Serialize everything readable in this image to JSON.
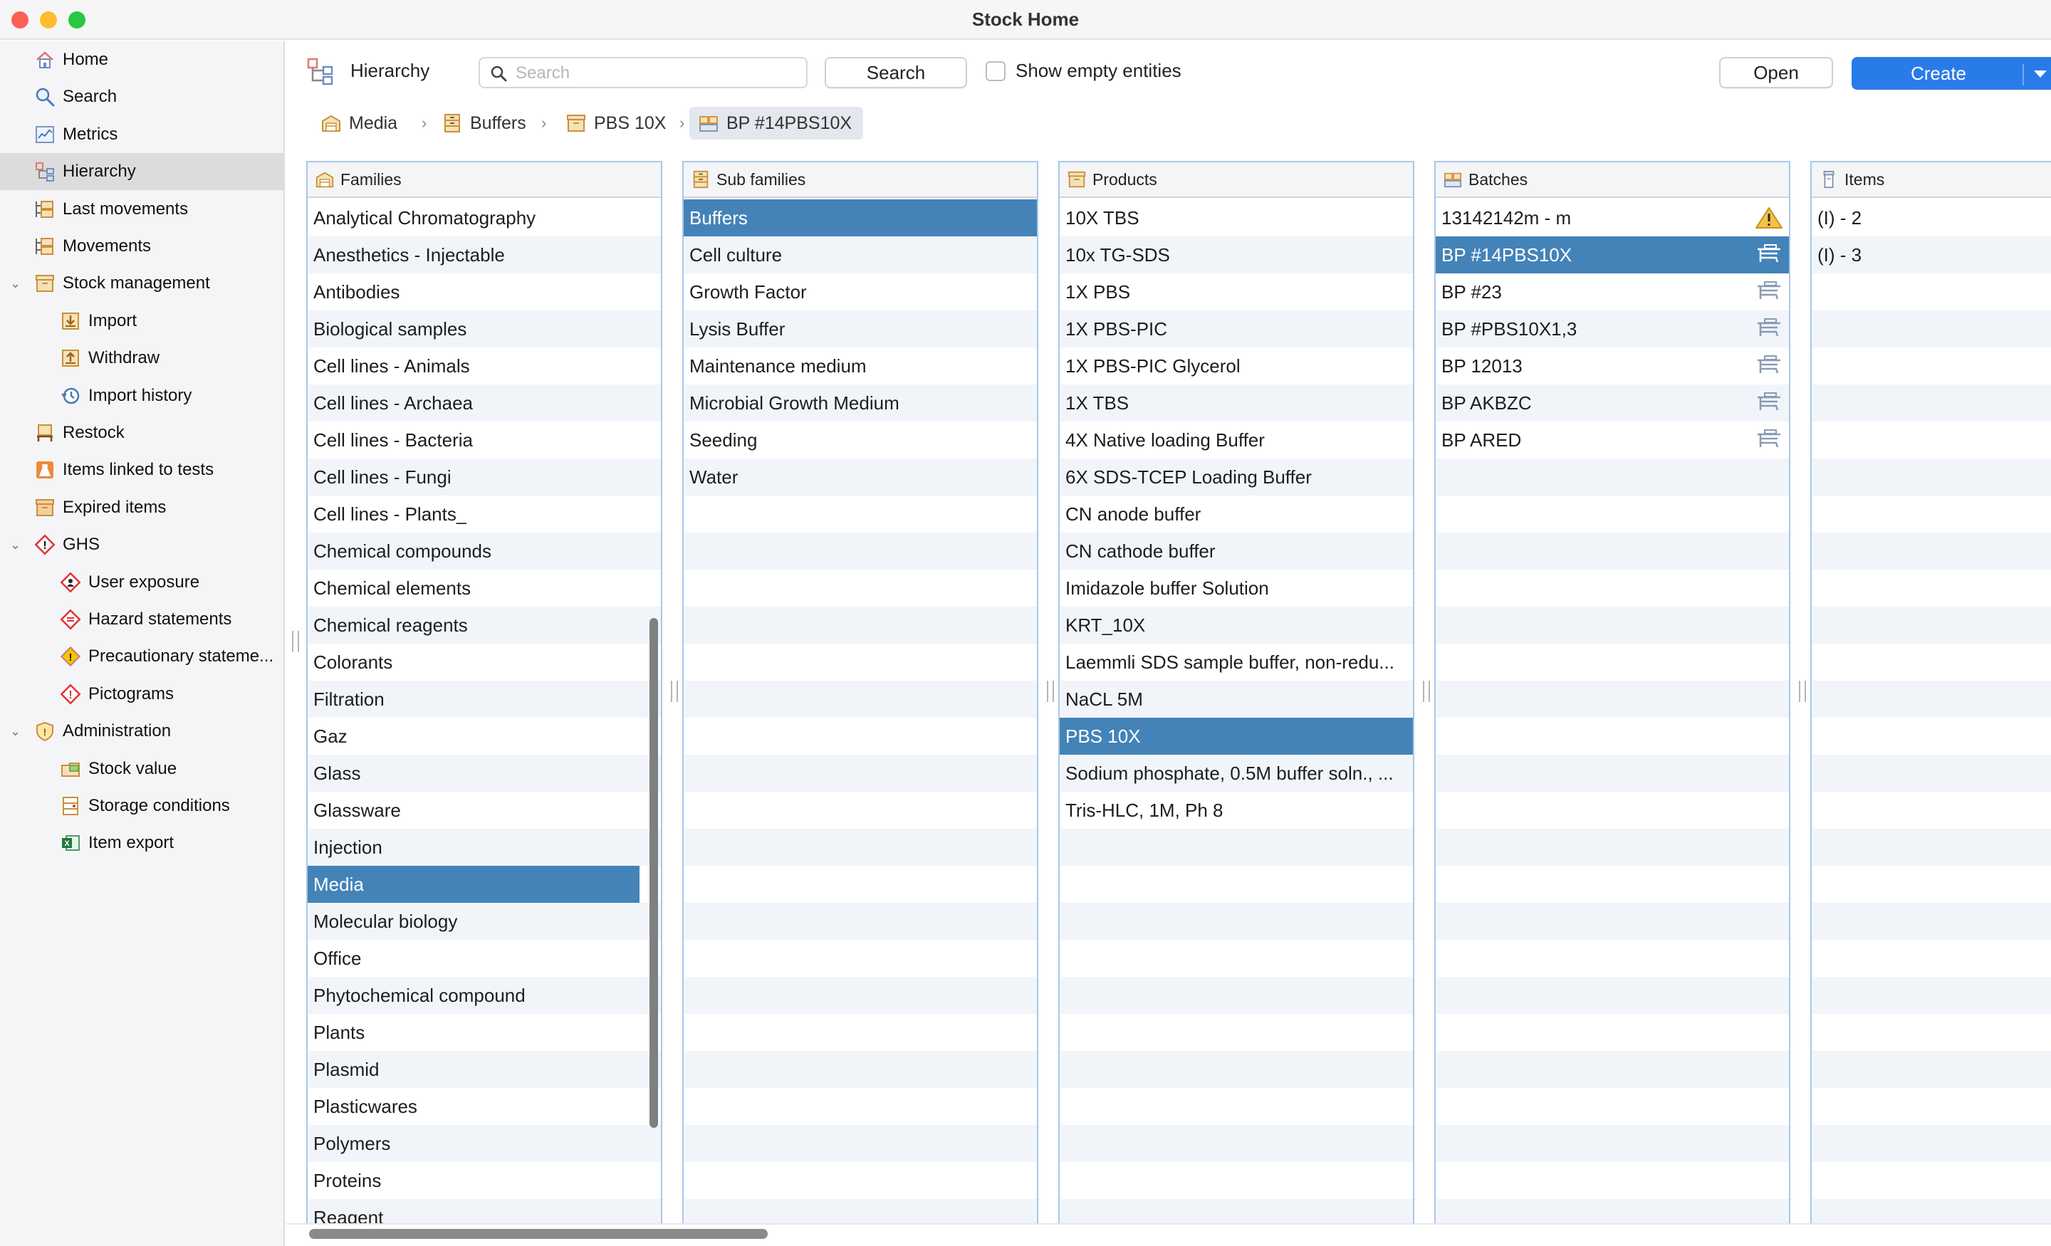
{
  "window": {
    "title": "Stock Home"
  },
  "colors": {
    "accent": "#2a7bea",
    "selection": "#4483b8",
    "column_border": "#a9c7e8"
  },
  "sidebar": {
    "items": [
      {
        "label": "Home",
        "icon": "home-icon",
        "indent": 0,
        "expandable": false,
        "selected": false
      },
      {
        "label": "Search",
        "icon": "search-icon",
        "indent": 0,
        "expandable": false,
        "selected": false
      },
      {
        "label": "Metrics",
        "icon": "metrics-icon",
        "indent": 0,
        "expandable": false,
        "selected": false
      },
      {
        "label": "Hierarchy",
        "icon": "hierarchy-icon",
        "indent": 0,
        "expandable": false,
        "selected": true
      },
      {
        "label": "Last movements",
        "icon": "movements-icon",
        "indent": 0,
        "expandable": false,
        "selected": false
      },
      {
        "label": "Movements",
        "icon": "movements-icon",
        "indent": 0,
        "expandable": false,
        "selected": false
      },
      {
        "label": "Stock management",
        "icon": "box-icon",
        "indent": 0,
        "expandable": true,
        "selected": false
      },
      {
        "label": "Import",
        "icon": "import-icon",
        "indent": 1,
        "expandable": false,
        "selected": false
      },
      {
        "label": "Withdraw",
        "icon": "withdraw-icon",
        "indent": 1,
        "expandable": false,
        "selected": false
      },
      {
        "label": "Import history",
        "icon": "history-icon",
        "indent": 1,
        "expandable": false,
        "selected": false
      },
      {
        "label": "Restock",
        "icon": "restock-icon",
        "indent": 0,
        "expandable": false,
        "selected": false
      },
      {
        "label": "Items linked to tests",
        "icon": "flask-icon",
        "indent": 0,
        "expandable": false,
        "selected": false
      },
      {
        "label": "Expired items",
        "icon": "expired-icon",
        "indent": 0,
        "expandable": false,
        "selected": false
      },
      {
        "label": "GHS",
        "icon": "ghs-icon",
        "indent": 0,
        "expandable": true,
        "selected": false
      },
      {
        "label": "User exposure",
        "icon": "exposure-icon",
        "indent": 1,
        "expandable": false,
        "selected": false
      },
      {
        "label": "Hazard statements",
        "icon": "hazard-icon",
        "indent": 1,
        "expandable": false,
        "selected": false
      },
      {
        "label": "Precautionary stateme...",
        "icon": "precaution-icon",
        "indent": 1,
        "expandable": false,
        "selected": false
      },
      {
        "label": "Pictograms",
        "icon": "pictogram-icon",
        "indent": 1,
        "expandable": false,
        "selected": false
      },
      {
        "label": "Administration",
        "icon": "shield-icon",
        "indent": 0,
        "expandable": true,
        "selected": false
      },
      {
        "label": "Stock value",
        "icon": "stock-value-icon",
        "indent": 1,
        "expandable": false,
        "selected": false
      },
      {
        "label": "Storage conditions",
        "icon": "storage-icon",
        "indent": 1,
        "expandable": false,
        "selected": false
      },
      {
        "label": "Item export",
        "icon": "excel-icon",
        "indent": 1,
        "expandable": false,
        "selected": false
      }
    ]
  },
  "toolbar": {
    "title": "Hierarchy",
    "search_placeholder": "Search",
    "search_value": "",
    "search_button": "Search",
    "show_empty_label": "Show empty entities",
    "show_empty_checked": false,
    "open_button": "Open",
    "create_button": "Create"
  },
  "breadcrumb": [
    {
      "label": "Media",
      "icon": "family-icon",
      "active": false
    },
    {
      "label": "Buffers",
      "icon": "subfamily-icon",
      "active": false
    },
    {
      "label": "PBS 10X",
      "icon": "product-icon",
      "active": false
    },
    {
      "label": "BP #14PBS10X",
      "icon": "batch-icon",
      "active": true
    }
  ],
  "columns": [
    {
      "key": "families",
      "title": "Families",
      "icon": "family-icon",
      "selected": "Media",
      "items": [
        "Analytical Chromatography",
        "Anesthetics - Injectable",
        "Antibodies",
        "Biological samples",
        "Cell lines - Animals",
        "Cell lines - Archaea",
        "Cell lines - Bacteria",
        "Cell lines - Fungi",
        "Cell lines - Plants_",
        "Chemical compounds",
        "Chemical elements",
        "Chemical reagents",
        "Colorants",
        "Filtration",
        "Gaz",
        "Glass",
        "Glassware",
        "Injection",
        "Media",
        "Molecular biology",
        "Office",
        "Phytochemical compound",
        "Plants",
        "Plasmid",
        "Plasticwares",
        "Polymers",
        "Proteins",
        "Reagent"
      ]
    },
    {
      "key": "subfamilies",
      "title": "Sub families",
      "icon": "subfamily-icon",
      "selected": "Buffers",
      "items": [
        "Buffers",
        "Cell culture",
        "Growth Factor",
        "Lysis Buffer",
        "Maintenance medium",
        "Microbial Growth Medium",
        "Seeding",
        "Water"
      ]
    },
    {
      "key": "products",
      "title": "Products",
      "icon": "product-icon",
      "selected": "PBS 10X",
      "items": [
        "10X TBS",
        "10x TG-SDS",
        "1X PBS",
        "1X PBS-PIC",
        "1X PBS-PIC Glycerol",
        "1X TBS",
        "4X Native loading Buffer",
        "6X SDS-TCEP Loading Buffer",
        "CN anode buffer",
        "CN cathode buffer",
        "Imidazole buffer Solution",
        "KRT_10X",
        "Laemmli SDS sample buffer, non-redu...",
        "NaCL 5M",
        "PBS 10X",
        "Sodium phosphate, 0.5M buffer soln., ...",
        "Tris-HLC, 1M, Ph 8"
      ]
    },
    {
      "key": "batches",
      "title": "Batches",
      "icon": "batch-icon",
      "selected": "BP #14PBS10X",
      "items": [
        "13142142m - m",
        "BP #14PBS10X",
        "BP #23",
        "BP #PBS10X1,3",
        "BP 12013",
        "BP AKBZC",
        "BP ARED"
      ],
      "row_icons": [
        "warning-icon",
        "shelf-icon",
        "shelf-icon",
        "shelf-icon",
        "shelf-icon",
        "shelf-icon",
        "shelf-icon"
      ]
    },
    {
      "key": "items",
      "title": "Items",
      "icon": "item-icon",
      "selected": "",
      "items": [
        "(I) - 2",
        "(I) - 3"
      ]
    }
  ]
}
